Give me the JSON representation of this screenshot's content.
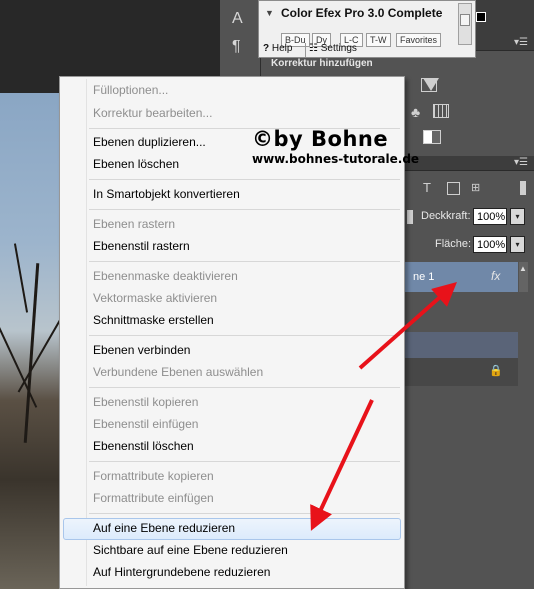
{
  "plugin_popup": {
    "title": "Color Efex Pro 3.0 Complete",
    "tabs": [
      "B-Du",
      "Dy",
      "L-C",
      "T-W",
      "Favorites"
    ],
    "help_label": "Help",
    "settings_label": "Settings"
  },
  "adjustments_panel": {
    "header": "Korrektur hinzufügen"
  },
  "layers_panel": {
    "opacity_label": "Deckkraft:",
    "opacity_value": "100%",
    "fill_label": "Fläche:",
    "fill_value": "100%",
    "active_layer_name": "ne 1",
    "fx_label": "fx"
  },
  "watermark": {
    "title": "©by Bohne",
    "url": "www.bohnes-tutorale.de"
  },
  "context_menu": {
    "groups": [
      [
        {
          "label": "Fülloptionen...",
          "enabled": false
        },
        {
          "label": "Korrektur bearbeiten...",
          "enabled": false
        }
      ],
      [
        {
          "label": "Ebenen duplizieren...",
          "enabled": true
        },
        {
          "label": "Ebenen löschen",
          "enabled": true
        }
      ],
      [
        {
          "label": "In Smartobjekt konvertieren",
          "enabled": true
        }
      ],
      [
        {
          "label": "Ebenen rastern",
          "enabled": false
        },
        {
          "label": "Ebenenstil rastern",
          "enabled": true
        }
      ],
      [
        {
          "label": "Ebenenmaske deaktivieren",
          "enabled": false
        },
        {
          "label": "Vektormaske aktivieren",
          "enabled": false
        },
        {
          "label": "Schnittmaske erstellen",
          "enabled": true
        }
      ],
      [
        {
          "label": "Ebenen verbinden",
          "enabled": true
        },
        {
          "label": "Verbundene Ebenen auswählen",
          "enabled": false
        }
      ],
      [
        {
          "label": "Ebenenstil kopieren",
          "enabled": false
        },
        {
          "label": "Ebenenstil einfügen",
          "enabled": false
        },
        {
          "label": "Ebenenstil löschen",
          "enabled": true
        }
      ],
      [
        {
          "label": "Formattribute kopieren",
          "enabled": false
        },
        {
          "label": "Formattribute einfügen",
          "enabled": false
        }
      ],
      [
        {
          "label": "Auf eine Ebene reduzieren",
          "enabled": true,
          "highlighted": true
        },
        {
          "label": "Sichtbare auf eine Ebene reduzieren",
          "enabled": true
        },
        {
          "label": "Auf Hintergrundebene reduzieren",
          "enabled": true
        }
      ]
    ]
  },
  "colors": {
    "arrow": "#e8121a",
    "highlight_border": "#a9c6eb",
    "selected_layer": "#7088a8"
  }
}
